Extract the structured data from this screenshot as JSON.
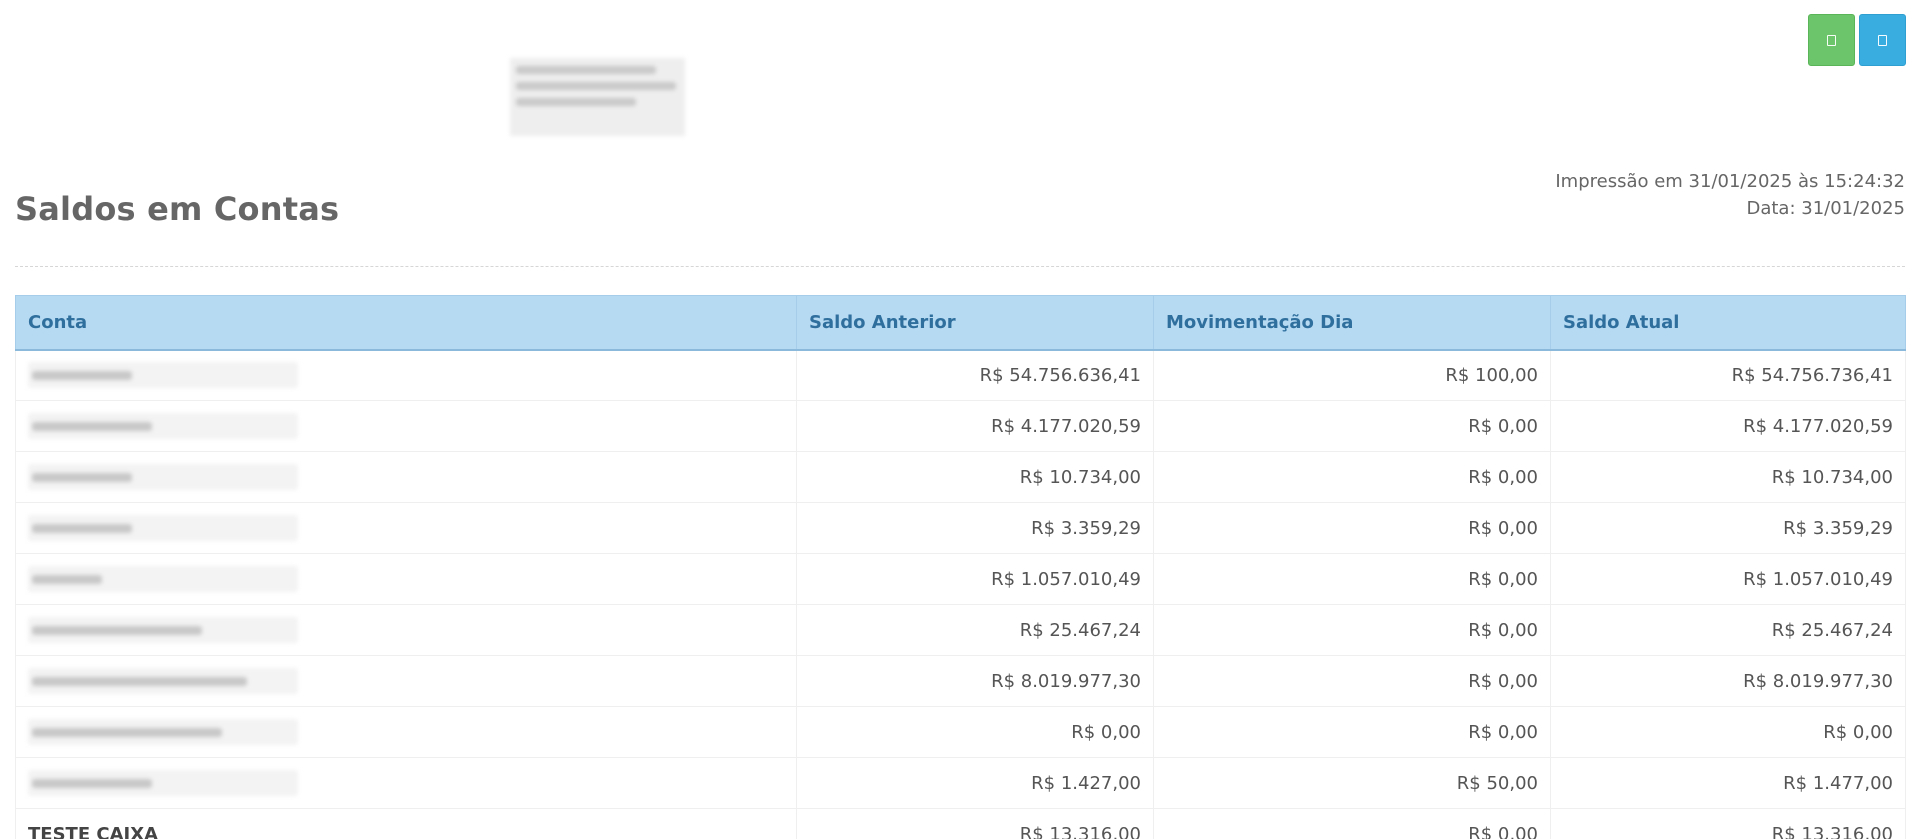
{
  "toolbar": {
    "print_icon": "print-icon",
    "export_icon": "export-icon",
    "colors": {
      "green": "#6cc56a",
      "blue": "#3aade0"
    }
  },
  "header": {
    "title": "Saldos em Contas",
    "printed_at": "Impressão em 31/01/2025 às 15:24:32",
    "date": "Data: 31/01/2025"
  },
  "table": {
    "columns": [
      "Conta",
      "Saldo Anterior",
      "Movimentação Dia",
      "Saldo Atual"
    ],
    "rows": [
      {
        "conta": "",
        "saldo_anterior": "R$ 54.756.636,41",
        "movimentacao": "R$ 100,00",
        "saldo_atual": "R$ 54.756.736,41"
      },
      {
        "conta": "",
        "saldo_anterior": "R$ 4.177.020,59",
        "movimentacao": "R$ 0,00",
        "saldo_atual": "R$ 4.177.020,59"
      },
      {
        "conta": "",
        "saldo_anterior": "R$ 10.734,00",
        "movimentacao": "R$ 0,00",
        "saldo_atual": "R$ 10.734,00"
      },
      {
        "conta": "",
        "saldo_anterior": "R$ 3.359,29",
        "movimentacao": "R$ 0,00",
        "saldo_atual": "R$ 3.359,29"
      },
      {
        "conta": "",
        "saldo_anterior": "R$ 1.057.010,49",
        "movimentacao": "R$ 0,00",
        "saldo_atual": "R$ 1.057.010,49"
      },
      {
        "conta": "",
        "saldo_anterior": "R$ 25.467,24",
        "movimentacao": "R$ 0,00",
        "saldo_atual": "R$ 25.467,24"
      },
      {
        "conta": "",
        "saldo_anterior": "R$ 8.019.977,30",
        "movimentacao": "R$ 0,00",
        "saldo_atual": "R$ 8.019.977,30"
      },
      {
        "conta": "",
        "saldo_anterior": "R$ 0,00",
        "movimentacao": "R$ 0,00",
        "saldo_atual": "R$ 0,00"
      },
      {
        "conta": "",
        "saldo_anterior": "R$ 1.427,00",
        "movimentacao": "R$ 50,00",
        "saldo_atual": "R$ 1.477,00"
      },
      {
        "conta": "TESTE CAIXA",
        "saldo_anterior": "R$ 13.316,00",
        "movimentacao": "R$ 0,00",
        "saldo_atual": "R$ 13.316,00"
      }
    ]
  }
}
